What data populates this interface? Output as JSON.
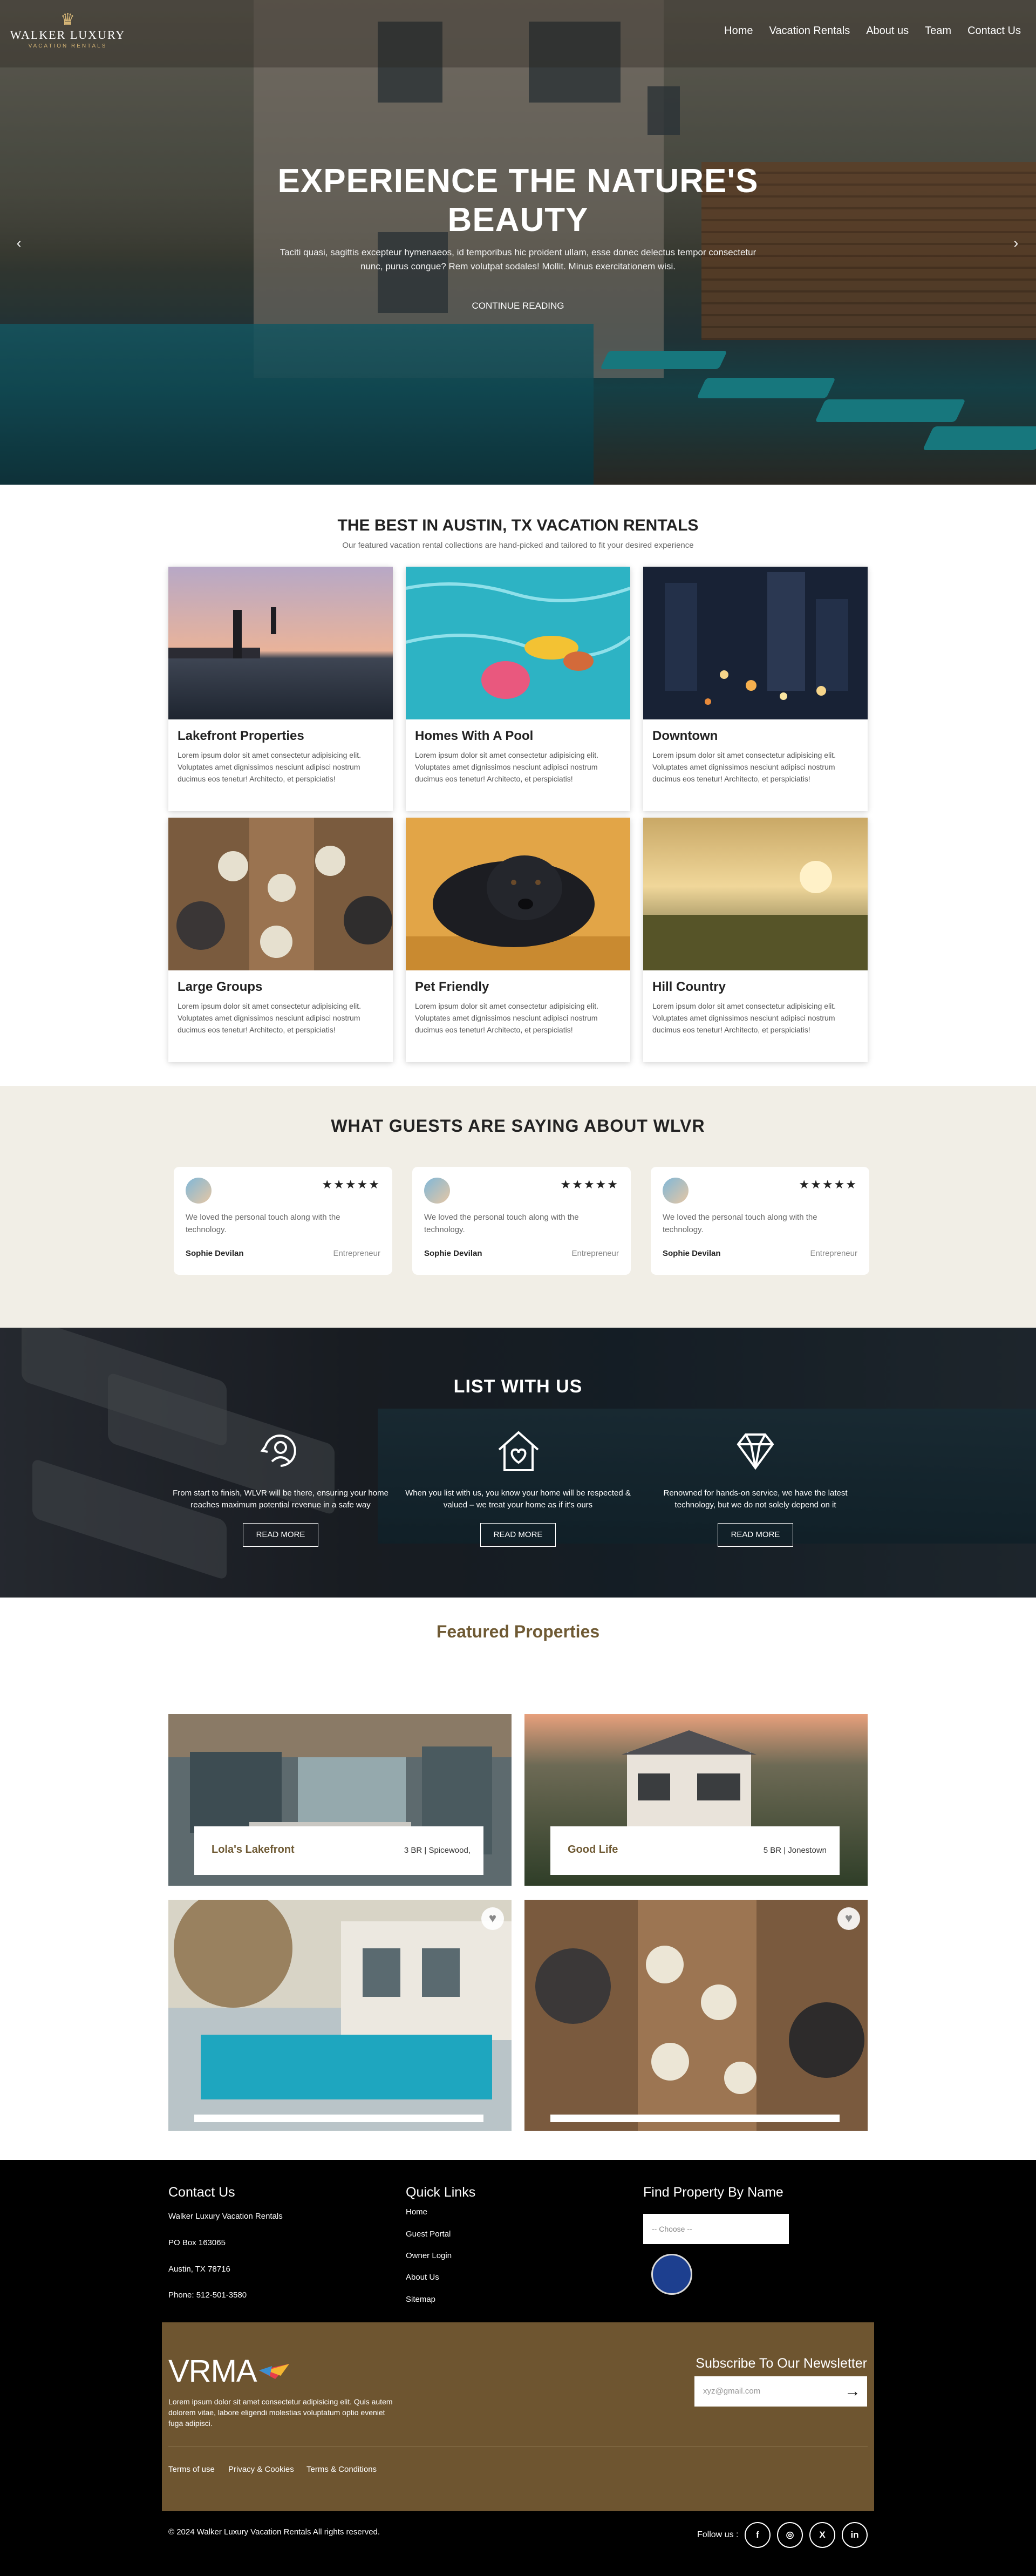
{
  "brand": {
    "name": "WALKER LUXURY",
    "tagline": "VACATION RENTALS"
  },
  "nav": [
    "Home",
    "Vacation Rentals",
    "About us",
    "Team",
    "Contact Us"
  ],
  "hero": {
    "title": "EXPERIENCE THE NATURE'S BEAUTY",
    "text": "Taciti quasi, sagittis excepteur hymenaeos, id temporibus hic proident ullam, esse donec delectus tempor consectetur nunc, purus congue? Rem volutpat sodales! Mollit. Minus exercitationem wisi.",
    "button": "CONTINUE READING",
    "prev": "‹",
    "next": "›"
  },
  "best": {
    "title": "THE BEST IN AUSTIN, TX VACATION RENTALS",
    "subtitle": "Our featured vacation rental collections are hand-picked and tailored to fit your desired experience",
    "cards": [
      {
        "title": "Lakefront Properties",
        "text": "Lorem ipsum dolor sit amet consectetur adipisicing elit. Voluptates amet dignissimos nesciunt adipisci nostrum ducimus eos tenetur! Architecto, et perspiciatis!"
      },
      {
        "title": "Homes With A Pool",
        "text": "Lorem ipsum dolor sit amet consectetur adipisicing elit. Voluptates amet dignissimos nesciunt adipisci nostrum ducimus eos tenetur! Architecto, et perspiciatis!"
      },
      {
        "title": "Downtown",
        "text": "Lorem ipsum dolor sit amet consectetur adipisicing elit. Voluptates amet dignissimos nesciunt adipisci nostrum ducimus eos tenetur! Architecto, et perspiciatis!"
      },
      {
        "title": "Large Groups",
        "text": "Lorem ipsum dolor sit amet consectetur adipisicing elit. Voluptates amet dignissimos nesciunt adipisci nostrum ducimus eos tenetur! Architecto, et perspiciatis!"
      },
      {
        "title": "Pet Friendly",
        "text": "Lorem ipsum dolor sit amet consectetur adipisicing elit. Voluptates amet dignissimos nesciunt adipisci nostrum ducimus eos tenetur! Architecto, et perspiciatis!"
      },
      {
        "title": "Hill Country",
        "text": "Lorem ipsum dolor sit amet consectetur adipisicing elit. Voluptates amet dignissimos nesciunt adipisci nostrum ducimus eos tenetur! Architecto, et perspiciatis!"
      }
    ]
  },
  "guests": {
    "title": "WHAT GUESTS ARE SAYING ABOUT WLVR",
    "items": [
      {
        "stars": "★★★★★",
        "quote": "We loved the personal touch along with the technology.",
        "name": "Sophie Devilan",
        "role": "Entrepreneur"
      },
      {
        "stars": "★★★★★",
        "quote": "We loved the personal touch along with the technology.",
        "name": "Sophie Devilan",
        "role": "Entrepreneur"
      },
      {
        "stars": "★★★★★",
        "quote": "We loved the personal touch along with the technology.",
        "name": "Sophie Devilan",
        "role": "Entrepreneur"
      }
    ]
  },
  "list": {
    "title": "LIST WITH US",
    "items": [
      {
        "text": "From start to finish, WLVR will be there, ensuring your home reaches maximum potential revenue in a safe way",
        "button": "READ MORE"
      },
      {
        "text": "When you list with us, you know your home will be respected & valued – we treat your home as if it's ours",
        "button": "READ MORE"
      },
      {
        "text": "Renowned for hands-on service, we have the latest technology, but we do not solely depend on it",
        "button": "READ MORE"
      }
    ]
  },
  "featured": {
    "title": "Featured Properties",
    "items": [
      {
        "name": "Lola's Lakefront",
        "meta": "3 BR | Spicewood,"
      },
      {
        "name": "Good Life",
        "meta": "5 BR | Jonestown"
      }
    ],
    "heart": "♥"
  },
  "footer": {
    "contact_title": "Contact Us",
    "contact_lines": [
      "Walker Luxury Vacation Rentals",
      "PO Box 163065",
      "Austin, TX 78716",
      "Phone: 512-501-3580"
    ],
    "links_title": "Quick Links",
    "links": [
      "Home",
      "Guest Portal",
      "Owner Login",
      "About Us",
      "Sitemap"
    ],
    "find_title": "Find Property By Name",
    "select_value": "-- Choose --",
    "vrma": "VRMA",
    "vrma_text": "Lorem ipsum dolor sit amet consectetur adipisicing elit. Quis autem dolorem vitae, labore eligendi molestias voluptatum optio eveniet fuga adipisci.",
    "newsletter_title": "Subscribe To Our Newsletter",
    "newsletter_placeholder": "xyz@gmail.com",
    "newsletter_arrow": "→",
    "legal": [
      "Terms of use",
      "Privacy & Cookies",
      "Terms & Conditions"
    ],
    "copyright": "© 2024 Walker Luxury Vacation Rentals All rights reserved.",
    "follow": "Follow us :",
    "social": [
      "f",
      "◎",
      "X",
      "in"
    ]
  }
}
